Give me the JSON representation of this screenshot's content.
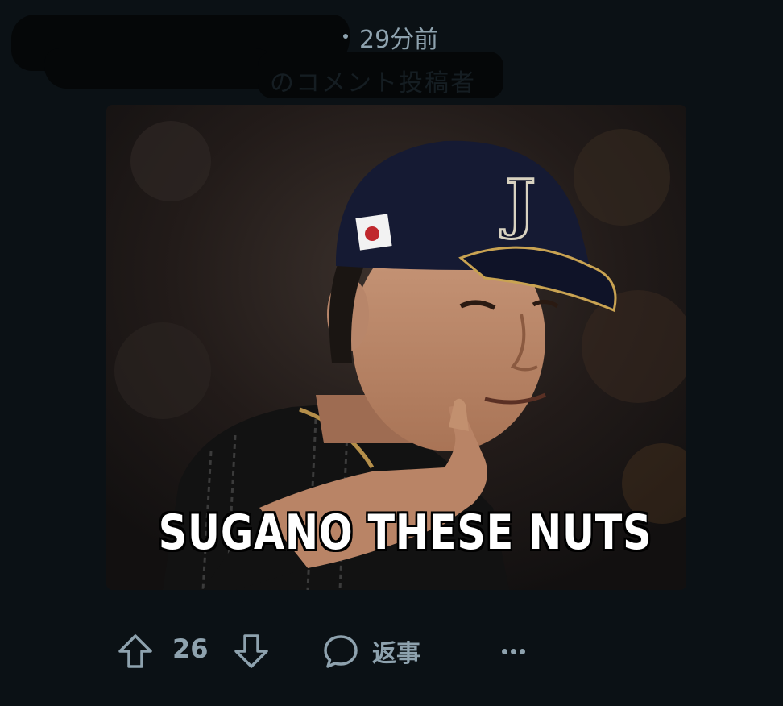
{
  "header": {
    "username_redacted": "",
    "faint_label": "のコメント投稿者",
    "timestamp": "29分前"
  },
  "post_image": {
    "caption": "SUGANO THESE NUTS",
    "cap_letter": "J"
  },
  "actions": {
    "score": "26",
    "reply_label": "返事",
    "upvote_icon": "arrow-up-icon",
    "downvote_icon": "arrow-down-icon",
    "reply_icon": "speech-bubble-icon",
    "more_icon": "ellipsis-icon"
  },
  "colors": {
    "background": "#0b1115",
    "muted_text": "#8ea2ae"
  }
}
